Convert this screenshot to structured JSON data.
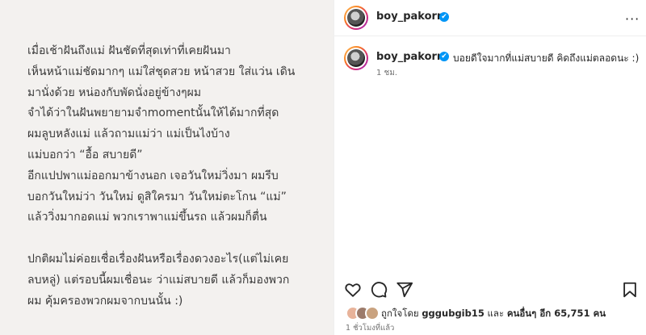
{
  "post": {
    "lines": [
      "เมื่อเช้าฝันถึงแม่ ฝันชัดที่สุดเท่าที่เคยฝันมา",
      "เห็นหน้าแม่ชัดมากๆ แม่ใส่ชุดสวย หน้าสวย ใส่แว่น เดิน",
      "มานั่งด้วย หน่องกับพัดนั่งอยู่ข้างๆผม",
      "จำได้ว่าในฝันพยายามจำmomentนั้นให้ได้มากที่สุด",
      "ผมลูบหลังแม่ แล้วถามแม่ว่า แม่เป็นไงบ้าง",
      "แม่บอกว่า “อื้อ สบายดี”",
      "อีกแปปพาแม่ออกมาข้างนอก เจอวันใหม่วิ่งมา ผมรีบ",
      "บอกวันใหม่ว่า วันใหม่ ดูสิใครมา วันใหม่ตะโกน “แม่”",
      "แล้ววิ่งมากอดแม่ พวกเราพาแม่ขึ้นรถ แล้วผมก็ตื่น",
      "",
      "ปกติผมไม่ค่อยเชื่อเรื่องฝันหรือเรื่องดวงอะไร(แต่ไม่เคย",
      "ลบหลู่) แต่รอบนี้ผมเชื่อนะ ว่าแม่สบายดี แล้วก็มองพวก",
      "ผม คุ้มครองพวกผมจากบนนั้น :)"
    ]
  },
  "header": {
    "username": "boy_pakorn",
    "verified": "✔",
    "more": "···"
  },
  "caption": {
    "username": "boy_pakorn",
    "verified": "✔",
    "text": "บอยดีใจมากที่แม่สบายดี คิดถึงแม่ตลอดนะ :)",
    "time": "1 ชม."
  },
  "likes": {
    "prefix": "ถูกใจโดย",
    "user": "gggubgib15",
    "middle": "และ",
    "others": "คนอื่นๆ อีก 65,751 คน"
  },
  "post_time": "1 ชั่วโมงที่แล้ว",
  "icons": {
    "like": "heart-icon",
    "comment": "comment-icon",
    "share": "share-icon",
    "save": "bookmark-icon"
  },
  "colors": {
    "verified": "#0095f6",
    "text": "#262626",
    "muted": "#737373"
  }
}
